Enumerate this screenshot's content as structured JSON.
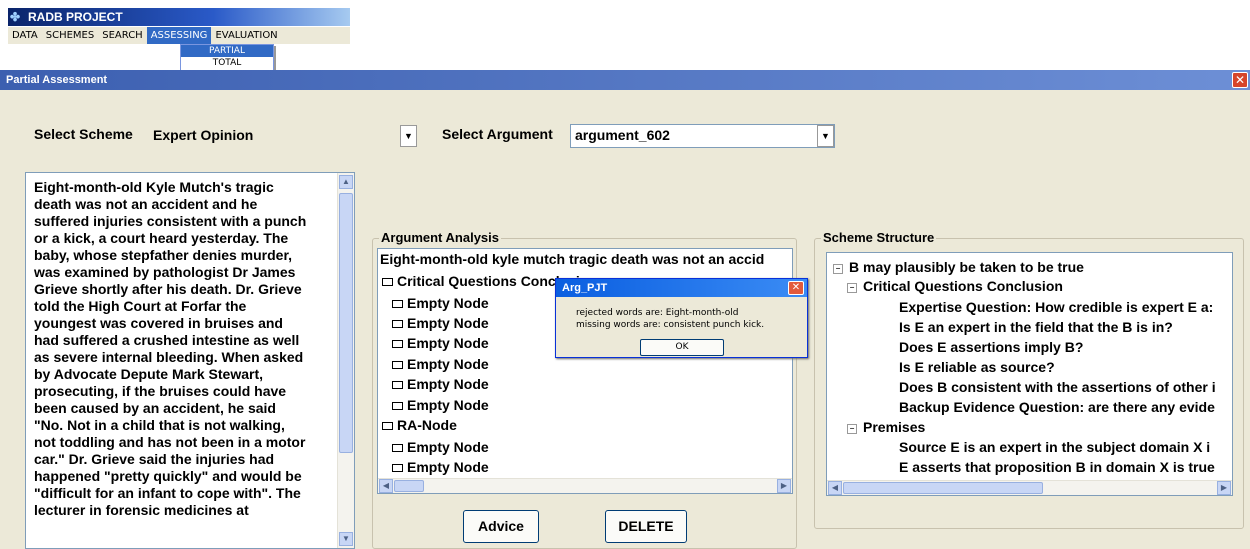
{
  "app": {
    "title": "RADB PROJECT",
    "menu": [
      "DATA",
      "SCHEMES",
      "SEARCH",
      "ASSESSING",
      "EVALUATION"
    ],
    "active_menu": "ASSESSING",
    "dropdown": [
      "PARTIAL",
      "TOTAL"
    ]
  },
  "dialog": {
    "title": "Partial Assessment",
    "close": "✕",
    "select_scheme_label": "Select Scheme",
    "scheme_value": "Expert Opinion",
    "select_argument_label": "Select Argument",
    "argument_value": "argument_602",
    "text": "Eight-month-old Kyle Mutch's tragic\ndeath was not an accident and he\nsuffered injuries consistent with a punch\nor a kick, a court heard yesterday. The\nbaby, whose stepfather denies murder,\nwas examined by pathologist Dr James\nGrieve shortly after his death. Dr. Grieve\ntold the High Court at Forfar the\nyoungest was covered in bruises and\nhad suffered a crushed intestine as well\nas severe internal bleeding. When asked\nby Advocate Depute Mark Stewart,\nprosecuting, if the bruises could have\nbeen caused by an accident, he said\n\"No. Not in a child that is not walking,\nnot toddling and has not been in a motor\ncar.\" Dr. Grieve said the injuries had\nhappened \"pretty quickly\" and would be\n\"difficult for an infant to cope with\". The\nlecturer in forensic medicines at",
    "analysis": {
      "title": "Argument Analysis",
      "header": "Eight-month-old kyle mutch tragic death was not an accid",
      "cq_node": "Critical Questions Conclusion",
      "cq_children": [
        "Empty Node",
        "Empty Node",
        "Empty Node",
        "Empty Node",
        "Empty Node",
        "Empty Node"
      ],
      "ra_node": "RA-Node",
      "ra_children": [
        "Empty Node",
        "Empty Node"
      ]
    },
    "scheme_structure": {
      "title": "Scheme Structure",
      "root": "B may plausibly be taken to be true",
      "cq_node": "Critical Questions Conclusion",
      "cq_items": [
        "Expertise Question: How credible is expert E a:",
        "Is E an expert in the field that the B is in?",
        "Does E assertions imply B?",
        "Is E reliable as source?",
        "Does B consistent with the assertions of other i",
        "Backup Evidence Question: are there any evide"
      ],
      "premises_node": "Premises",
      "premise_items": [
        "Source E is an expert in the subject domain X i",
        "E asserts that proposition B in domain X is true"
      ]
    },
    "advice_button": "Advice",
    "delete_button": "DELETE"
  },
  "message_box": {
    "title": "Arg_PJT",
    "close": "✕",
    "line1": "rejected words are:  Eight-month-old",
    "line2": "missing words are:  consistent punch kick.",
    "ok": "OK"
  }
}
